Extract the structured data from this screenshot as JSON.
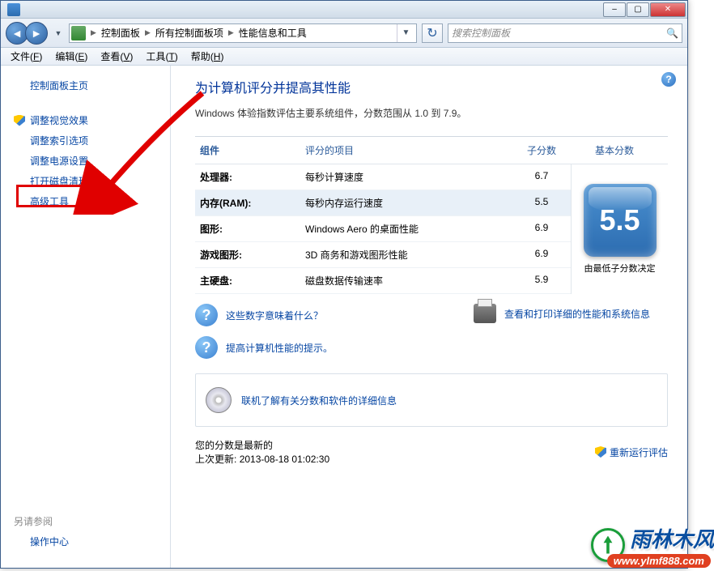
{
  "titlebar": {
    "minimize": "–",
    "maximize": "▢",
    "close": "✕"
  },
  "breadcrumbs": {
    "items": [
      "控制面板",
      "所有控制面板项",
      "性能信息和工具"
    ]
  },
  "search": {
    "placeholder": "搜索控制面板"
  },
  "menubar": {
    "items": [
      {
        "label": "文件",
        "hk": "F"
      },
      {
        "label": "编辑",
        "hk": "E"
      },
      {
        "label": "查看",
        "hk": "V"
      },
      {
        "label": "工具",
        "hk": "T"
      },
      {
        "label": "帮助",
        "hk": "H"
      }
    ]
  },
  "sidebar": {
    "home": "控制面板主页",
    "items": [
      {
        "label": "调整视觉效果",
        "shield": true
      },
      {
        "label": "调整索引选项",
        "shield": false
      },
      {
        "label": "调整电源设置",
        "shield": false
      },
      {
        "label": "打开磁盘清理",
        "shield": false
      },
      {
        "label": "高级工具",
        "shield": false
      }
    ],
    "see_also_heading": "另请参阅",
    "see_also": "操作中心"
  },
  "heading": "为计算机评分并提高其性能",
  "description": "Windows 体验指数评估主要系统组件，分数范围从 1.0 到 7.9。",
  "table": {
    "headers": {
      "component": "组件",
      "rated": "评分的项目",
      "sub": "子分数",
      "base": "基本分数"
    },
    "rows": [
      {
        "comp": "处理器:",
        "rated": "每秒计算速度",
        "sub": "6.7",
        "hl": false
      },
      {
        "comp": "内存(RAM):",
        "rated": "每秒内存运行速度",
        "sub": "5.5",
        "hl": true
      },
      {
        "comp": "图形:",
        "rated": "Windows Aero 的桌面性能",
        "sub": "6.9",
        "hl": false
      },
      {
        "comp": "游戏图形:",
        "rated": "3D 商务和游戏图形性能",
        "sub": "6.9",
        "hl": false
      },
      {
        "comp": "主硬盘:",
        "rated": "磁盘数据传输速率",
        "sub": "5.9",
        "hl": false
      }
    ],
    "base_score": "5.5",
    "base_label": "由最低子分数决定"
  },
  "links": {
    "q1": "这些数字意味着什么？",
    "q2": "提高计算机性能的提示。",
    "print": "查看和打印详细的性能和系统信息",
    "online": "联机了解有关分数和软件的详细信息"
  },
  "footer": {
    "status": "您的分数是最新的",
    "updated_label": "上次更新:",
    "updated_value": "2013-08-18 01:02:30",
    "rerun": "重新运行评估"
  },
  "watermark": {
    "text": "雨林木风",
    "url": "www.ylmf888.com"
  }
}
